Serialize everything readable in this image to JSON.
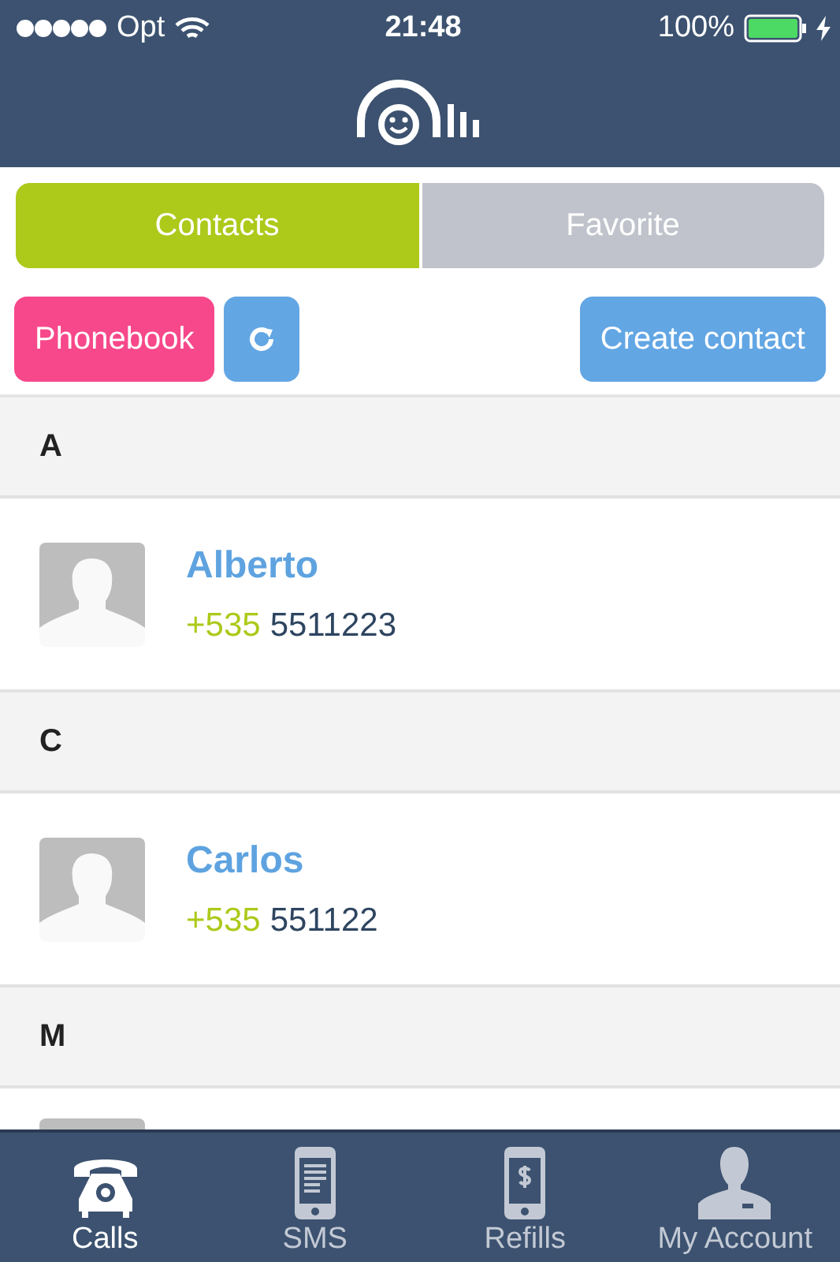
{
  "status_bar": {
    "carrier": "Opt",
    "time": "21:48",
    "battery": "100%"
  },
  "segments": [
    {
      "label": "Contacts",
      "selected": true
    },
    {
      "label": "Favorite",
      "selected": false
    }
  ],
  "actions": {
    "phonebook": "Phonebook",
    "create": "Create contact"
  },
  "sections": [
    {
      "letter": "A",
      "contacts": [
        {
          "kind": "full",
          "name": "Alberto",
          "country_code": "+535",
          "number": "5511223"
        }
      ]
    },
    {
      "letter": "C",
      "contacts": [
        {
          "kind": "full",
          "name": "Carlos",
          "country_code": "+535",
          "number": "551122"
        }
      ]
    },
    {
      "letter": "M",
      "contacts": [
        {
          "kind": "cut"
        }
      ]
    }
  ],
  "tab_bar": [
    {
      "label": "Calls",
      "kind": "phone",
      "selected": true
    },
    {
      "label": "SMS",
      "kind": "sms",
      "selected": false
    },
    {
      "label": "Refills",
      "kind": "refill",
      "selected": false
    },
    {
      "label": "My Account",
      "kind": "account",
      "selected": false
    }
  ]
}
